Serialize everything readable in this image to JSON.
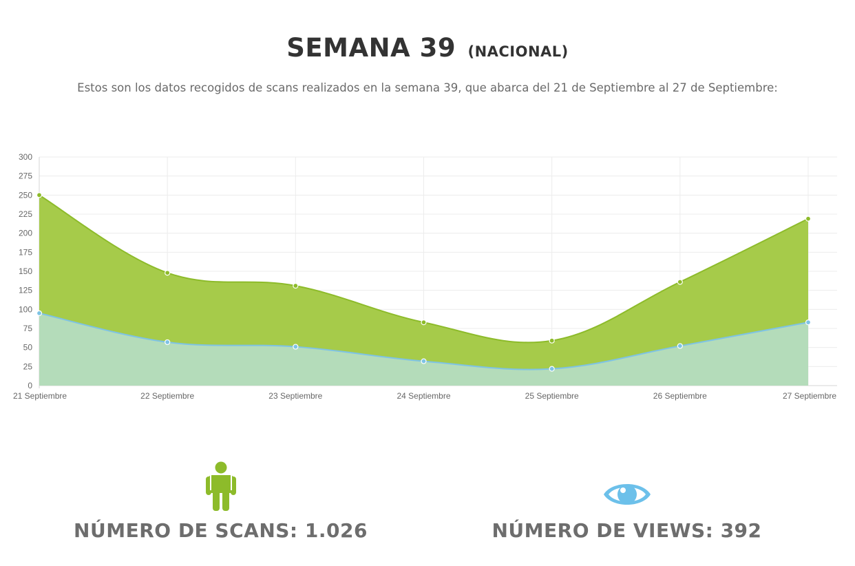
{
  "header": {
    "title": "SEMANA 39",
    "title_region": "(NACIONAL)",
    "subtitle": "Estos son los datos recogidos de scans realizados en la semana 39, que abarca del 21 de Septiembre al 27 de Septiembre:"
  },
  "chart_data": {
    "type": "area",
    "categories": [
      "21 Septiembre",
      "22 Septiembre",
      "23 Septiembre",
      "24 Septiembre",
      "25 Septiembre",
      "26 Septiembre",
      "27 Septiembre"
    ],
    "series": [
      {
        "values": [
          250,
          148,
          131,
          83,
          59,
          136,
          219
        ],
        "color": "#a6cb4a",
        "line_color": "#8dbb2a"
      },
      {
        "values": [
          95,
          57,
          51,
          32,
          22,
          52,
          83
        ],
        "color": "#b4dcba",
        "line_color": "#7ec3e4"
      }
    ],
    "ylim": [
      0,
      300
    ],
    "yticks": [
      0,
      25,
      50,
      75,
      100,
      125,
      150,
      175,
      200,
      225,
      250,
      275,
      300
    ],
    "grid": true,
    "legend": "none"
  },
  "stats": {
    "scans": {
      "label": "NÚMERO DE SCANS: 1.026",
      "icon": "person-icon",
      "color": "#8dbb2a"
    },
    "views": {
      "label": "NÚMERO DE VIEWS: 392",
      "icon": "eye-icon",
      "color": "#6cc0ea"
    }
  }
}
